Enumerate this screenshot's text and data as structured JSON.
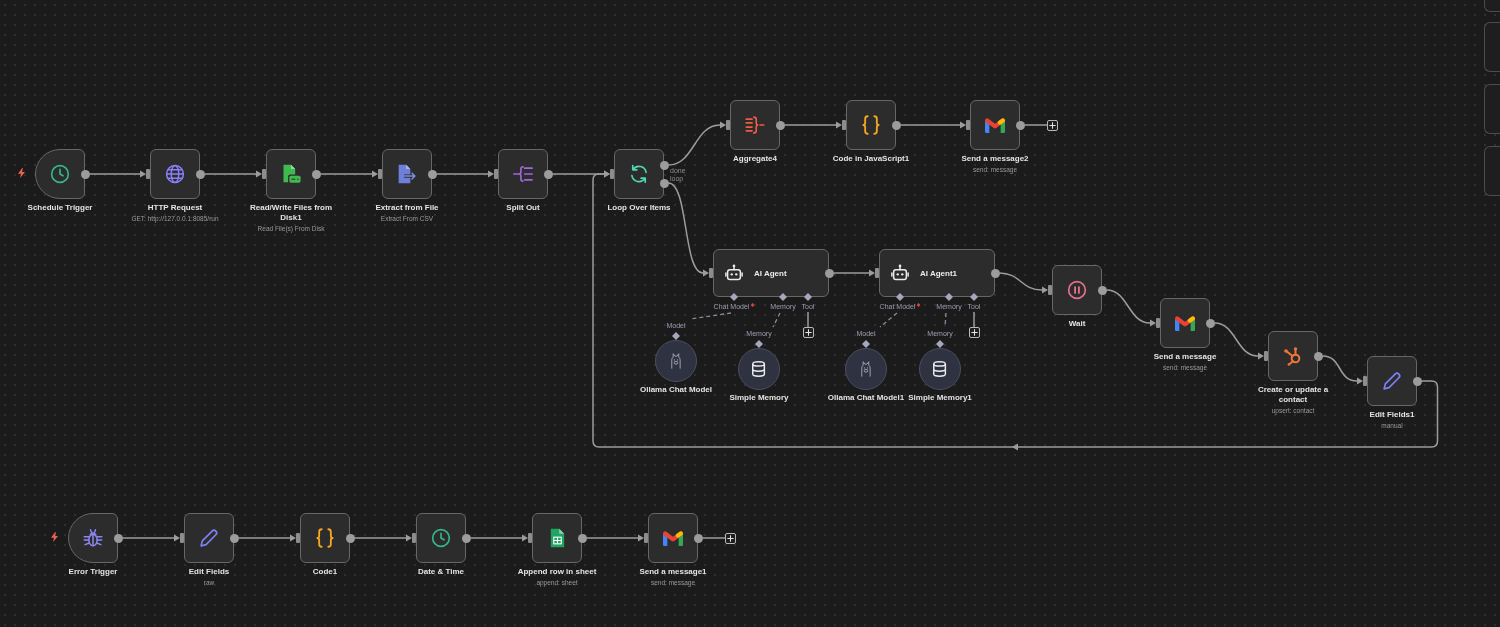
{
  "canvas": {
    "workflows": [
      {
        "nodes": [
          {
            "kind": "trigger",
            "name": "Schedule Trigger",
            "add_button": false
          },
          {
            "kind": "action",
            "name": "HTTP Request",
            "subtitle": "GET: http://127.0.0.1:8085/run",
            "add_button": false
          },
          {
            "kind": "action",
            "name": "Read/Write Files from Disk1",
            "subtitle": "Read File(s) From Disk",
            "add_button": false
          },
          {
            "kind": "action",
            "name": "Extract from File",
            "subtitle": "Extract From CSV",
            "add_button": false
          },
          {
            "kind": "action",
            "name": "Split Out",
            "add_button": false
          },
          {
            "kind": "action",
            "name": "Loop Over Items",
            "outputs": [
              "done",
              "loop"
            ],
            "add_button": false
          },
          {
            "kind": "action",
            "name": "Aggregate4",
            "add_button": false
          },
          {
            "kind": "action",
            "name": "Code in JavaScript1",
            "add_button": false
          },
          {
            "kind": "action",
            "name": "Send a message2",
            "subtitle": "send: message",
            "add_button": true
          },
          {
            "kind": "agent",
            "name": "AI Agent",
            "add_button": false,
            "ports": [
              {
                "label": "Chat Model",
                "required": true,
                "add_button": false,
                "node": {
                  "name": "Ollama Chat Model",
                  "input": "Model"
                }
              },
              {
                "label": "Memory",
                "required": false,
                "add_button": false,
                "node": {
                  "name": "Simple Memory",
                  "input": "Memory"
                }
              },
              {
                "label": "Tool",
                "required": false,
                "add_button": true
              }
            ]
          },
          {
            "kind": "agent",
            "name": "AI Agent1",
            "add_button": false,
            "ports": [
              {
                "label": "Chat Model",
                "required": true,
                "add_button": false,
                "node": {
                  "name": "Ollama Chat Model1",
                  "input": "Model"
                }
              },
              {
                "label": "Memory",
                "required": false,
                "add_button": false,
                "node": {
                  "name": "Simple Memory1",
                  "input": "Memory"
                }
              },
              {
                "label": "Tool",
                "required": false,
                "add_button": true
              }
            ]
          },
          {
            "kind": "action",
            "name": "Wait",
            "add_button": false
          },
          {
            "kind": "action",
            "name": "Send a message",
            "subtitle": "send: message",
            "add_button": false
          },
          {
            "kind": "action",
            "name": "Create or update a contact",
            "subtitle": "upsert: contact",
            "add_button": false
          },
          {
            "kind": "action",
            "name": "Edit Fields1",
            "subtitle": "manual",
            "add_button": false
          }
        ]
      },
      {
        "nodes": [
          {
            "kind": "trigger",
            "name": "Error Trigger",
            "add_button": false
          },
          {
            "kind": "action",
            "name": "Edit Fields",
            "subtitle": "raw",
            "add_button": false
          },
          {
            "kind": "action",
            "name": "Code1",
            "add_button": false
          },
          {
            "kind": "action",
            "name": "Date & Time",
            "add_button": false
          },
          {
            "kind": "action",
            "name": "Append row in sheet",
            "subtitle": "append: sheet",
            "add_button": false
          },
          {
            "kind": "action",
            "name": "Send a message1",
            "subtitle": "send: message",
            "add_button": true
          }
        ]
      }
    ]
  }
}
